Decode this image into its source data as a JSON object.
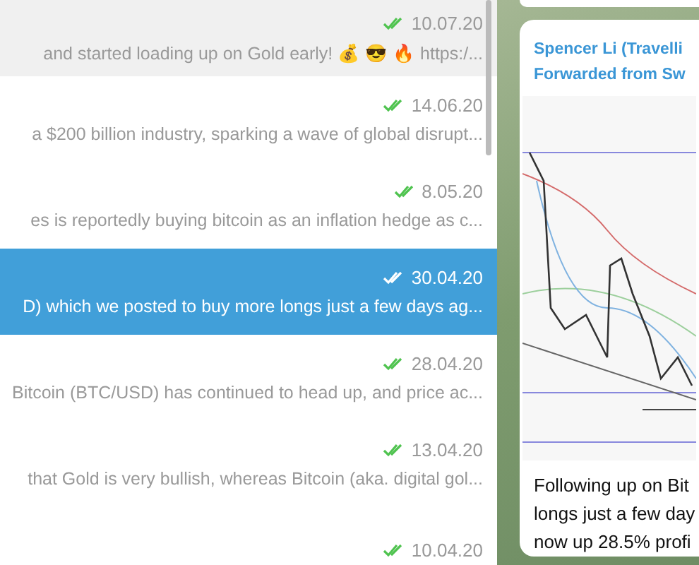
{
  "chats": [
    {
      "date": "10.07.20",
      "preview": "and started loading up on Gold early! 💰 😎 🔥  https:/...",
      "read": true,
      "selected": false,
      "hovered": true
    },
    {
      "date": "14.06.20",
      "preview": "a $200 billion industry, sparking a wave of global disrupt...",
      "read": true,
      "selected": false,
      "hovered": false
    },
    {
      "date": "8.05.20",
      "preview": "es is reportedly buying bitcoin as an inflation hedge as c...",
      "read": true,
      "selected": false,
      "hovered": false
    },
    {
      "date": "30.04.20",
      "preview": "D) which we posted to buy more longs just a few days ag...",
      "read": true,
      "selected": true,
      "hovered": false
    },
    {
      "date": "28.04.20",
      "preview": "Bitcoin (BTC/USD) has continued to head up, and price ac...",
      "read": true,
      "selected": false,
      "hovered": false
    },
    {
      "date": "13.04.20",
      "preview": "that Gold is very bullish, whereas Bitcoin (aka. digital gol...",
      "read": true,
      "selected": false,
      "hovered": false
    },
    {
      "date": "10.04.20",
      "read": true,
      "selected": false,
      "hovered": false
    }
  ],
  "message": {
    "sender": "Spencer Li (Travelli",
    "forwarded": "Forwarded from Sw",
    "lines": [
      "Following up on Bit",
      "longs just a few day",
      "now up 28.5% profi"
    ]
  }
}
